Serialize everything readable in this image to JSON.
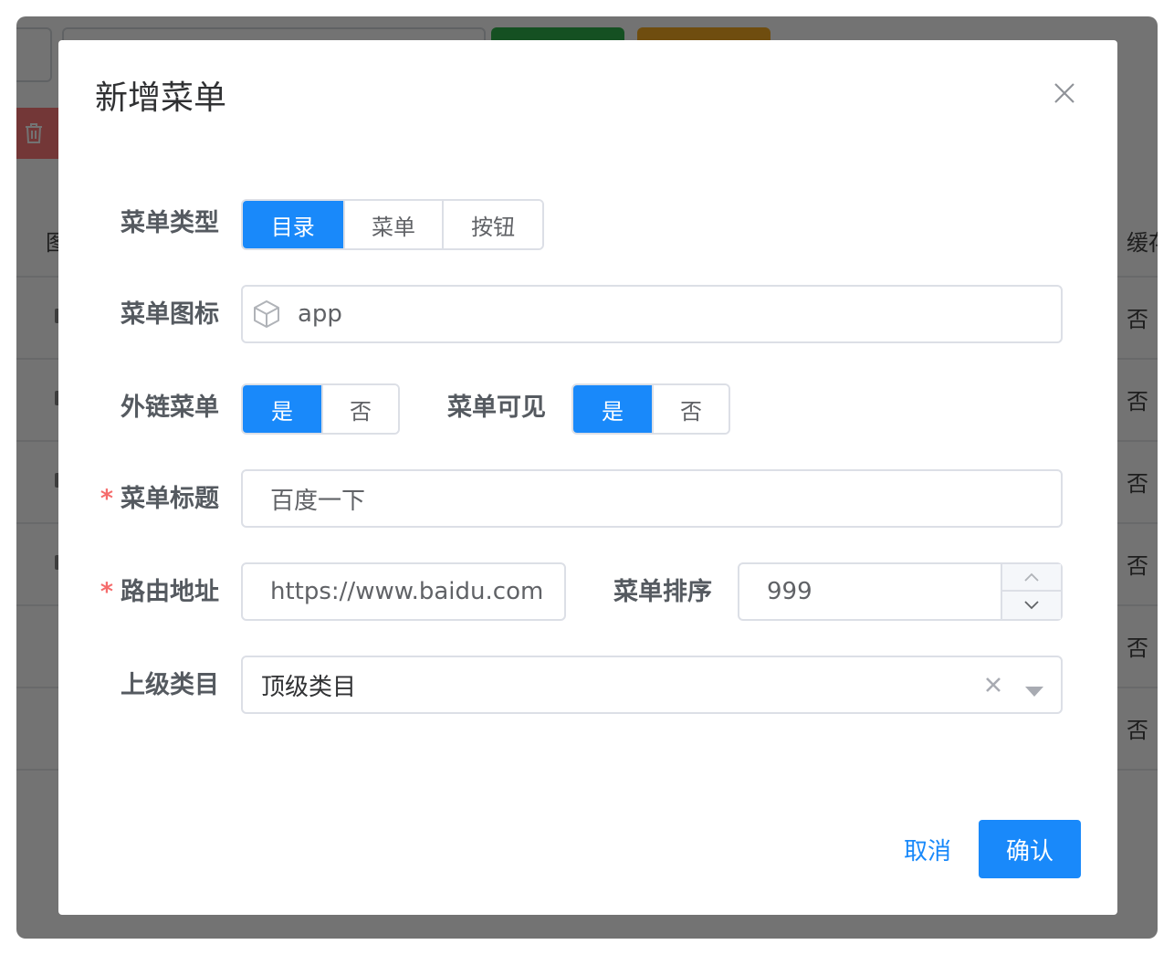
{
  "background": {
    "table_header_left": "图",
    "table_header_right": "缓存",
    "rows": [
      "否",
      "否",
      "否",
      "否",
      "否",
      "否"
    ]
  },
  "dialog": {
    "title": "新增菜单",
    "menu_type": {
      "label": "菜单类型",
      "options": [
        "目录",
        "菜单",
        "按钮"
      ],
      "selected": "目录"
    },
    "menu_icon": {
      "label": "菜单图标",
      "value": "app",
      "icon": "cube-icon"
    },
    "external_link": {
      "label": "外链菜单",
      "options": [
        "是",
        "否"
      ],
      "selected": "是"
    },
    "visible": {
      "label": "菜单可见",
      "options": [
        "是",
        "否"
      ],
      "selected": "是"
    },
    "menu_title": {
      "label": "菜单标题",
      "required_mark": "*",
      "value": "百度一下"
    },
    "route": {
      "label": "路由地址",
      "required_mark": "*",
      "value": "https://www.baidu.com"
    },
    "sort": {
      "label": "菜单排序",
      "value": "999"
    },
    "parent": {
      "label": "上级类目",
      "value": "顶级类目"
    },
    "cancel_label": "取消",
    "confirm_label": "确认"
  },
  "colors": {
    "primary": "#1989fa",
    "required": "#f56c6c",
    "bg_green": "#2fb24c",
    "bg_orange": "#f7ab22",
    "bg_red": "#ff7b7b"
  }
}
